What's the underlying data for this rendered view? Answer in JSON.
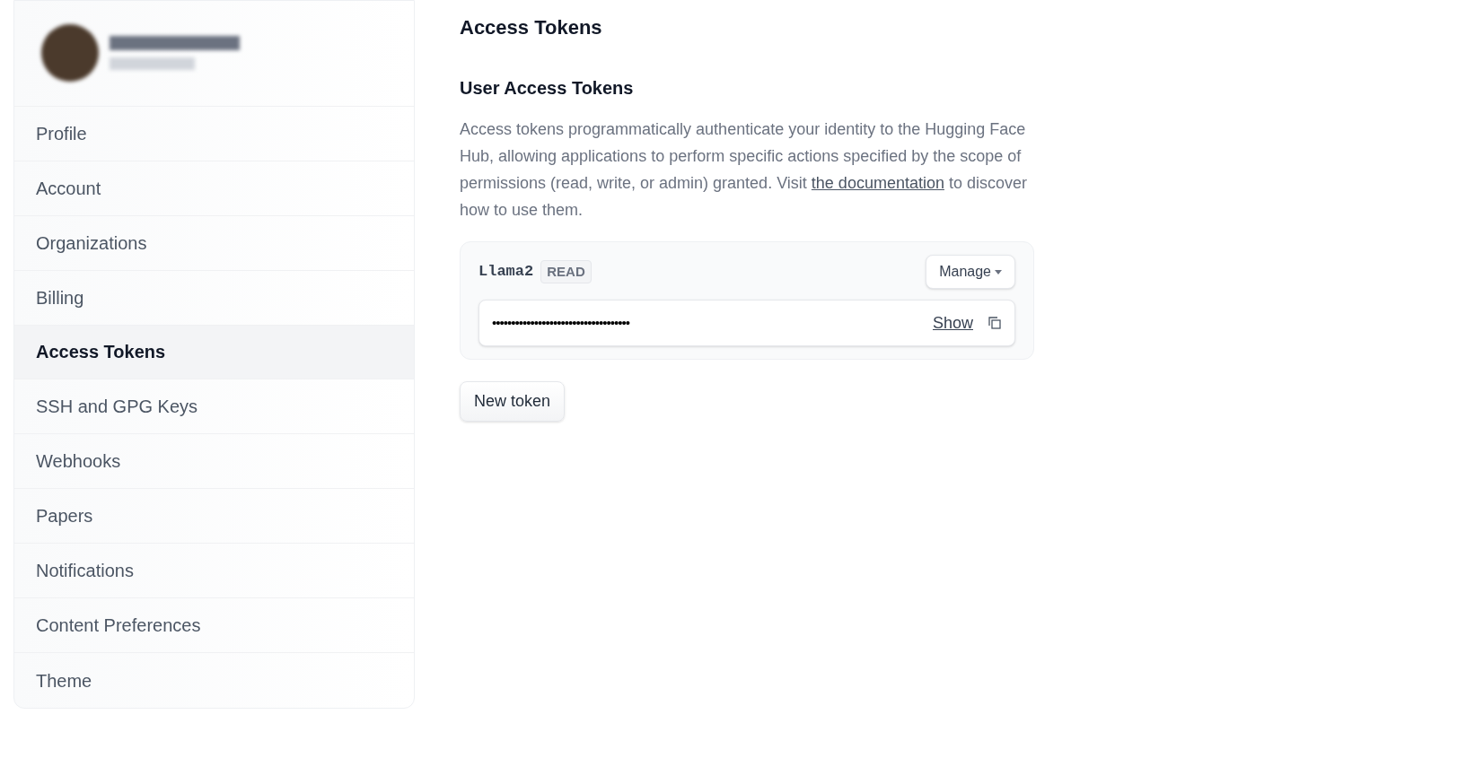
{
  "sidebar": {
    "items": [
      {
        "label": "Profile",
        "selected": false
      },
      {
        "label": "Account",
        "selected": false
      },
      {
        "label": "Organizations",
        "selected": false
      },
      {
        "label": "Billing",
        "selected": false
      },
      {
        "label": "Access Tokens",
        "selected": true
      },
      {
        "label": "SSH and GPG Keys",
        "selected": false
      },
      {
        "label": "Webhooks",
        "selected": false
      },
      {
        "label": "Papers",
        "selected": false
      },
      {
        "label": "Notifications",
        "selected": false
      },
      {
        "label": "Content Preferences",
        "selected": false
      },
      {
        "label": "Theme",
        "selected": false
      }
    ]
  },
  "page_title": "Access Tokens",
  "section_title": "User Access Tokens",
  "description": {
    "text_before": "Access tokens programmatically authenticate your identity to the Hugging Face Hub, allowing applications to perform specific actions specified by the scope of permissions (read, write, or admin) granted. Visit",
    "link": "the documentation",
    "text_after": "to discover how to use them."
  },
  "tokens": [
    {
      "name": "Llama2",
      "role": "READ",
      "manage_label": "Manage",
      "value": "••••••••••••••••••••••••••••••••••••",
      "show_label": "Show"
    }
  ],
  "new_token_button": "New token"
}
